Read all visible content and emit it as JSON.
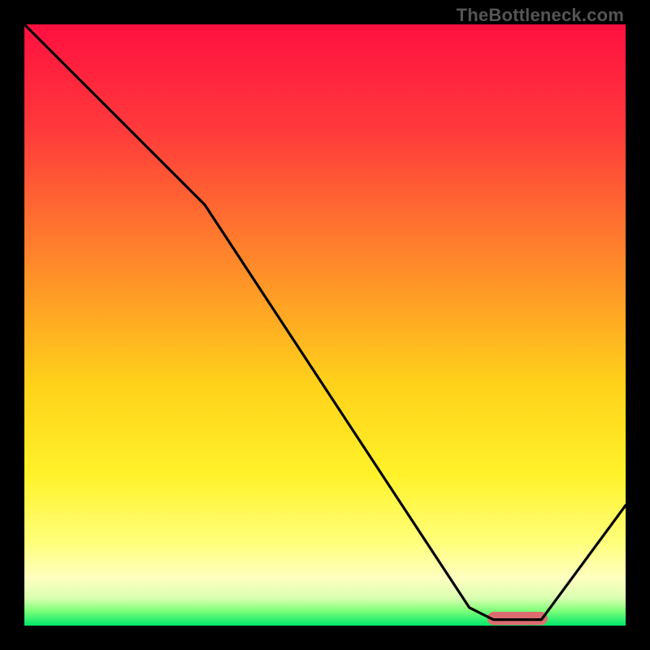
{
  "watermark": "TheBottleneck.com",
  "chart_data": {
    "type": "line",
    "title": "",
    "xlabel": "",
    "ylabel": "",
    "xlim": [
      0,
      100
    ],
    "ylim": [
      0,
      100
    ],
    "series": [
      {
        "name": "curve",
        "color": "#000000",
        "x": [
          0,
          8,
          24,
          30,
          74,
          78,
          86,
          100
        ],
        "y": [
          100,
          92,
          76,
          70,
          3,
          1,
          1,
          20
        ]
      }
    ],
    "markers": [
      {
        "name": "optimal-zone",
        "color": "#dd6b6f",
        "x_start": 77,
        "x_end": 87,
        "y": 1.2,
        "thickness": 2.2
      }
    ],
    "background_gradient": [
      {
        "offset": 0.0,
        "color": "#ff1040"
      },
      {
        "offset": 0.18,
        "color": "#ff3b3b"
      },
      {
        "offset": 0.4,
        "color": "#ff8a2a"
      },
      {
        "offset": 0.6,
        "color": "#ffd21a"
      },
      {
        "offset": 0.75,
        "color": "#fff22a"
      },
      {
        "offset": 0.86,
        "color": "#ffff7a"
      },
      {
        "offset": 0.92,
        "color": "#ffffc0"
      },
      {
        "offset": 0.955,
        "color": "#d9ffb0"
      },
      {
        "offset": 0.975,
        "color": "#7fff7a"
      },
      {
        "offset": 1.0,
        "color": "#00e66a"
      }
    ]
  }
}
